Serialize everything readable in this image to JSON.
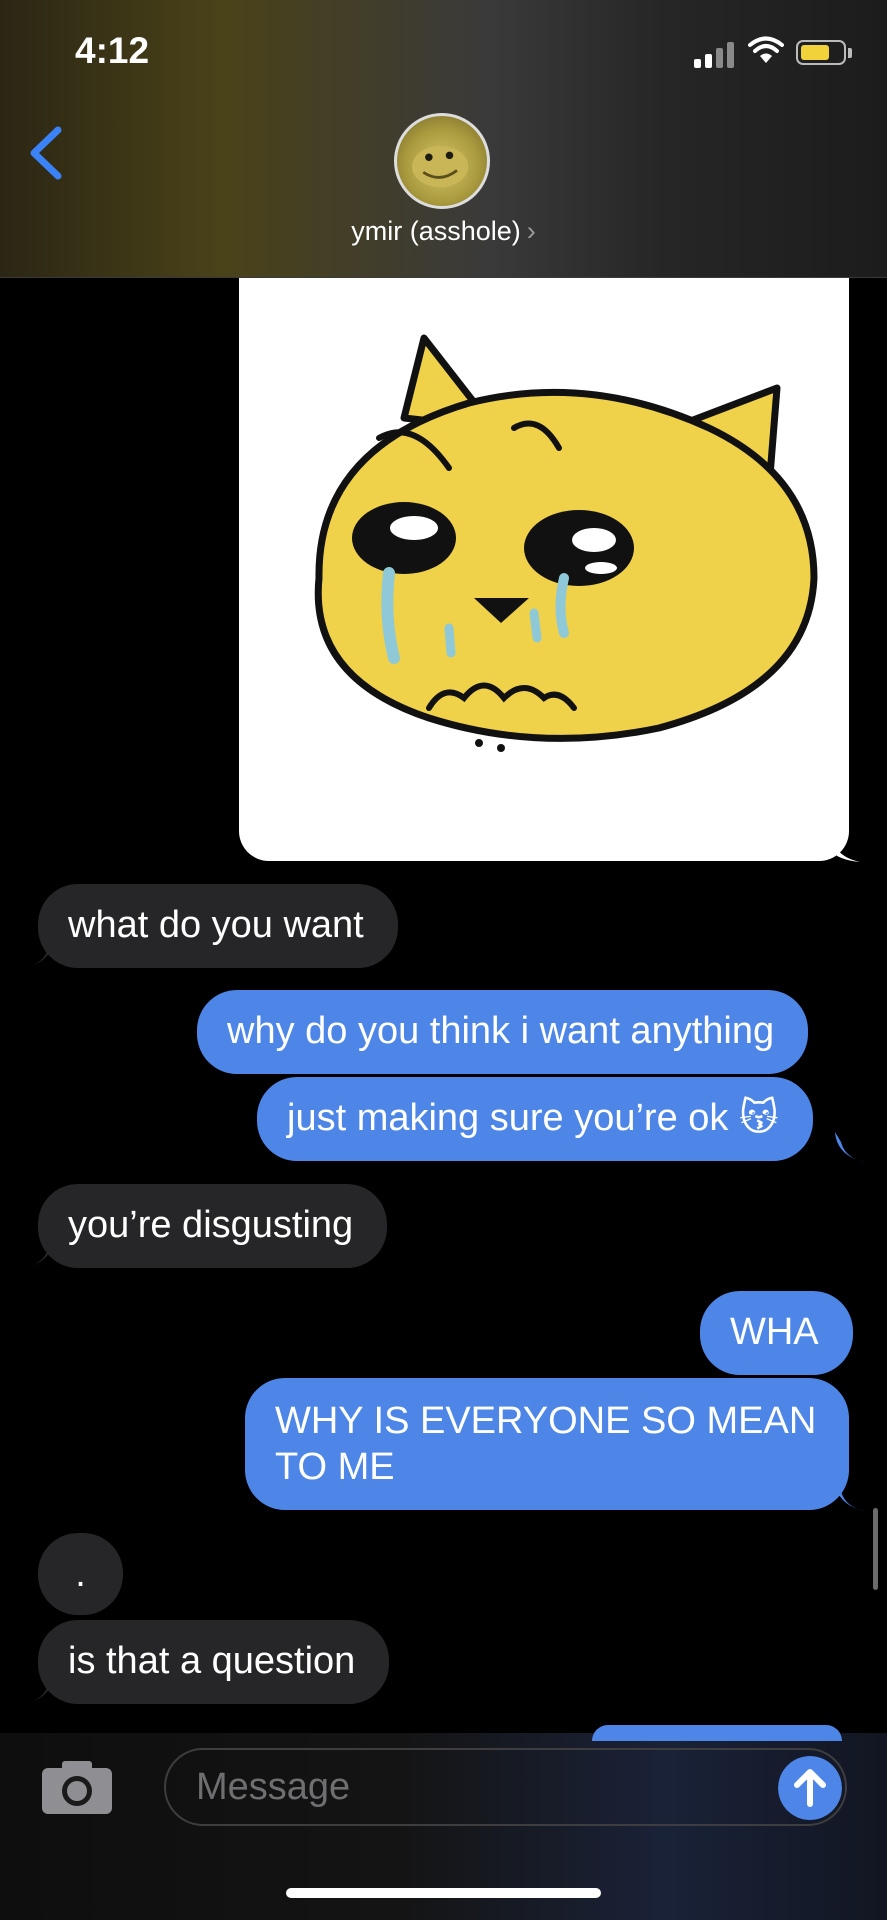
{
  "status_bar": {
    "time": "4:12"
  },
  "colors": {
    "accent_blue": "#4e86e8",
    "link_blue": "#3b82f6",
    "received_bubble": "#262628",
    "battery_fill": "#f2d23b",
    "sticker_yellow": "#f0d24a"
  },
  "header": {
    "contact_name": "ymir (asshole)",
    "chevron": "›",
    "back_icon": "chevron-left-icon"
  },
  "messages": [
    {
      "from": "them",
      "text": "what do you want"
    },
    {
      "from": "me",
      "text": "why do you think i want anything"
    },
    {
      "from": "me",
      "text": "just making sure you’re ok 😽"
    },
    {
      "from": "them",
      "text": "you’re disgusting"
    },
    {
      "from": "me",
      "text": "WHA"
    },
    {
      "from": "me",
      "text": "WHY IS EVERYONE SO MEAN",
      "text2": "TO ME"
    },
    {
      "from": "them",
      "text": "."
    },
    {
      "from": "them",
      "text": "is that a question"
    }
  ],
  "input": {
    "placeholder": "Message"
  }
}
